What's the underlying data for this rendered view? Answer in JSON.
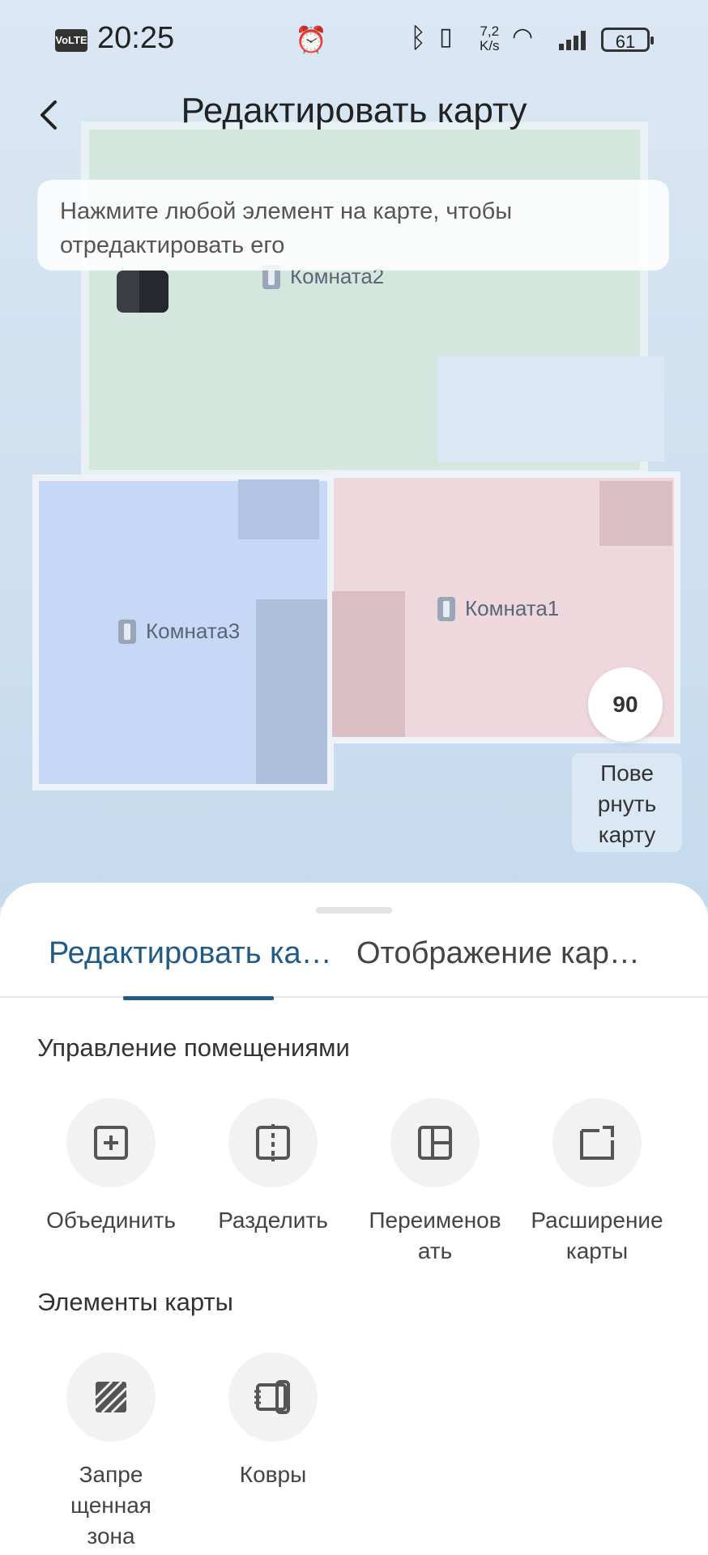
{
  "status_bar": {
    "volte": "VoLTE",
    "time": "20:25",
    "net_speed_value": "7,2",
    "net_speed_unit": "K/s",
    "battery": "61"
  },
  "header": {
    "title": "Редактировать карту"
  },
  "hint": "Нажмите любой элемент на карте, чтобы отредактировать его",
  "map": {
    "rooms": [
      {
        "label": "Комната2"
      },
      {
        "label": "Комната3"
      },
      {
        "label": "Комната1"
      }
    ],
    "rotate_value": "90",
    "rotate_label": "Повернуть карту"
  },
  "tabs": [
    {
      "label": "Редактировать ка…"
    },
    {
      "label": "Отображение кар…"
    }
  ],
  "sections": {
    "rooms_management": {
      "title": "Управление помещениями",
      "tools": [
        {
          "label": "Объединить",
          "icon": "merge-icon"
        },
        {
          "label": "Разделить",
          "icon": "split-icon"
        },
        {
          "label": "Переименовать",
          "icon": "rename-icon"
        },
        {
          "label": "Расширение карты",
          "icon": "expand-map-icon"
        }
      ]
    },
    "map_elements": {
      "title": "Элементы карты",
      "tools": [
        {
          "label": "Запрещенная зона",
          "icon": "no-go-zone-icon"
        },
        {
          "label": "Ковры",
          "icon": "carpet-icon"
        }
      ]
    }
  }
}
